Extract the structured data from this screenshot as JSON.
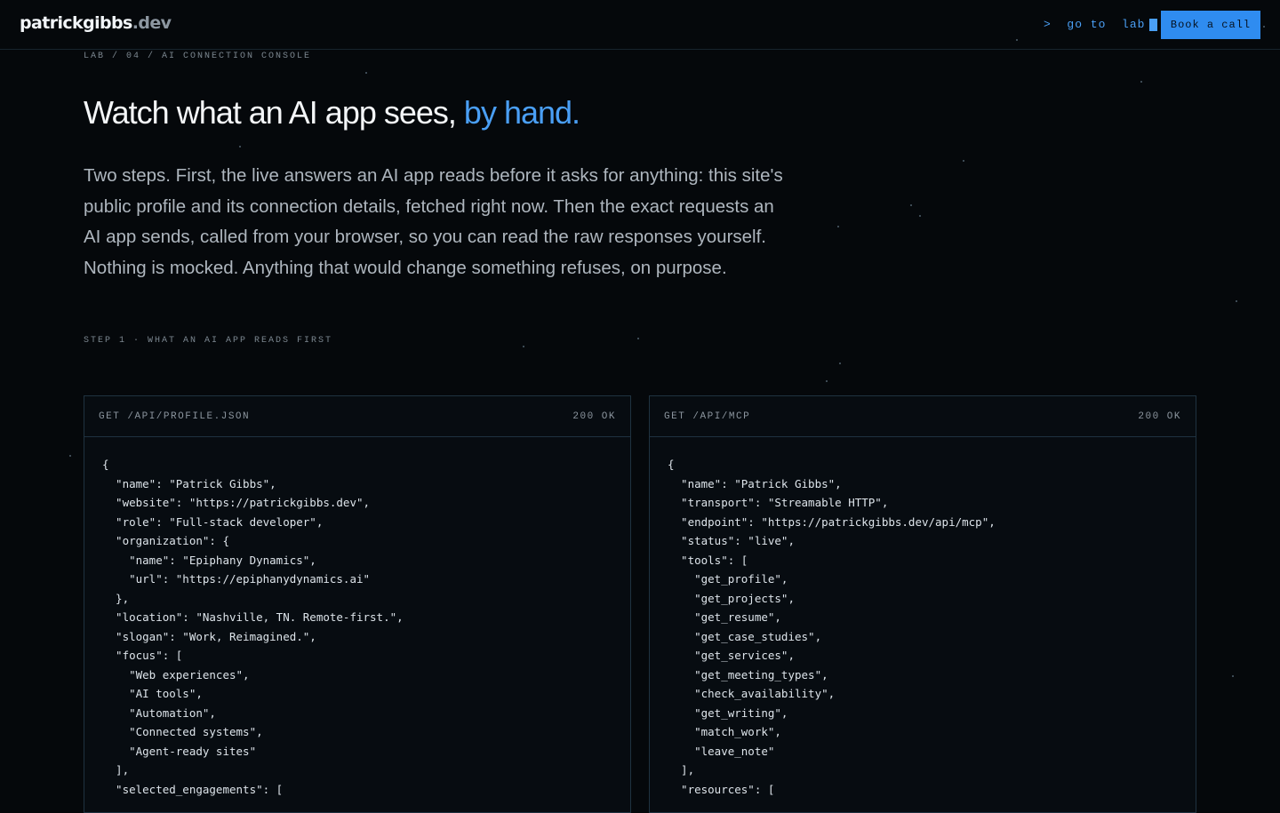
{
  "header": {
    "logo_name": "patrickgibbs",
    "logo_tld": ".dev",
    "goto_label": ">  go to  lab",
    "book_label": "Book a call"
  },
  "breadcrumb": "LAB / 04 / AI CONNECTION CONSOLE",
  "hero": {
    "title_main": "Watch what an AI app sees, ",
    "title_accent": "by hand.",
    "lede": "Two steps. First, the live answers an AI app reads before it asks for anything: this site's public profile and its connection details, fetched right now. Then the exact requests an AI app sends, called from your browser, so you can read the raw responses yourself. Nothing is mocked. Anything that would change something refuses, on purpose."
  },
  "step1_label": "STEP 1 · WHAT AN AI APP READS FIRST",
  "panels": [
    {
      "request": "GET /API/PROFILE.JSON",
      "status": "200 OK",
      "body": "{\n  \"name\": \"Patrick Gibbs\",\n  \"website\": \"https://patrickgibbs.dev\",\n  \"role\": \"Full-stack developer\",\n  \"organization\": {\n    \"name\": \"Epiphany Dynamics\",\n    \"url\": \"https://epiphanydynamics.ai\"\n  },\n  \"location\": \"Nashville, TN. Remote-first.\",\n  \"slogan\": \"Work, Reimagined.\",\n  \"focus\": [\n    \"Web experiences\",\n    \"AI tools\",\n    \"Automation\",\n    \"Connected systems\",\n    \"Agent-ready sites\"\n  ],\n  \"selected_engagements\": ["
    },
    {
      "request": "GET /API/MCP",
      "status": "200 OK",
      "body": "{\n  \"name\": \"Patrick Gibbs\",\n  \"transport\": \"Streamable HTTP\",\n  \"endpoint\": \"https://patrickgibbs.dev/api/mcp\",\n  \"status\": \"live\",\n  \"tools\": [\n    \"get_profile\",\n    \"get_projects\",\n    \"get_resume\",\n    \"get_case_studies\",\n    \"get_services\",\n    \"get_meeting_types\",\n    \"check_availability\",\n    \"get_writing\",\n    \"match_work\",\n    \"leave_note\"\n  ],\n  \"resources\": ["
    }
  ],
  "colors": {
    "background": "#05080b",
    "accent": "#4a9ff5",
    "button": "#2f8cf0",
    "panel_border": "#1f3240"
  },
  "icons": {
    "goto_cursor": "block-cursor-icon"
  }
}
